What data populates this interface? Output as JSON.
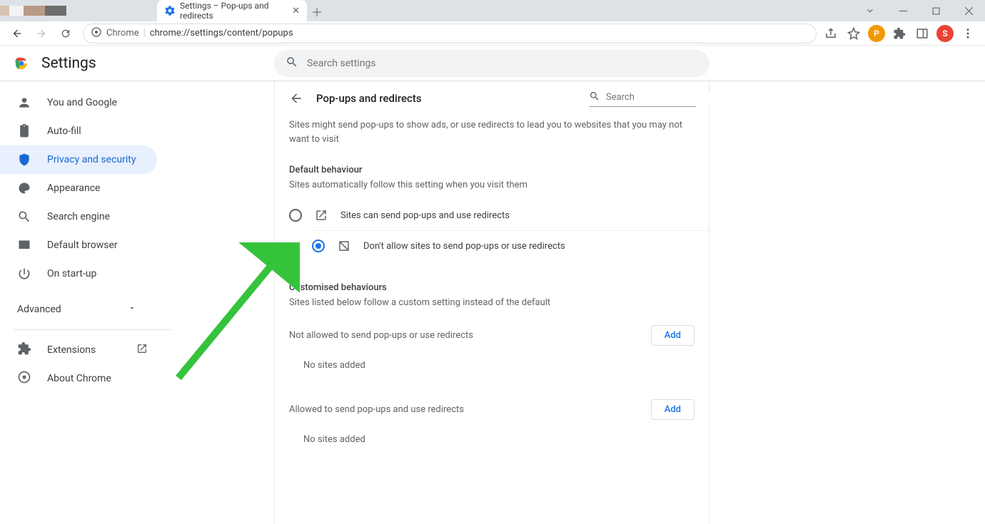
{
  "window": {
    "tab1_title": "",
    "tab2_title": "Settings – Pop-ups and redirects"
  },
  "toolbar": {
    "url_prefix": "Chrome",
    "url_rest": "chrome://settings/content/popups",
    "profile_letter": "S",
    "ext_letter": "P"
  },
  "header": {
    "title": "Settings",
    "search_placeholder": "Search settings"
  },
  "sidebar": {
    "items": [
      {
        "label": "You and Google"
      },
      {
        "label": "Auto-fill"
      },
      {
        "label": "Privacy and security"
      },
      {
        "label": "Appearance"
      },
      {
        "label": "Search engine"
      },
      {
        "label": "Default browser"
      },
      {
        "label": "On start-up"
      }
    ],
    "advanced_label": "Advanced",
    "extensions_label": "Extensions",
    "about_label": "About Chrome"
  },
  "content": {
    "breadcrumb_title": "Pop-ups and redirects",
    "search_placeholder": "Search",
    "intro": "Sites might send pop-ups to show ads, or use redirects to lead you to websites that you may not want to visit",
    "default_head": "Default behaviour",
    "default_sub": "Sites automatically follow this setting when you visit them",
    "radio_allow": "Sites can send pop-ups and use redirects",
    "radio_block": "Don't allow sites to send pop-ups or use redirects",
    "custom_head": "Customised behaviours",
    "custom_sub": "Sites listed below follow a custom setting instead of the default",
    "not_allowed_label": "Not allowed to send pop-ups or use redirects",
    "allowed_label": "Allowed to send pop-ups and use redirects",
    "add_label": "Add",
    "empty_label": "No sites added"
  }
}
